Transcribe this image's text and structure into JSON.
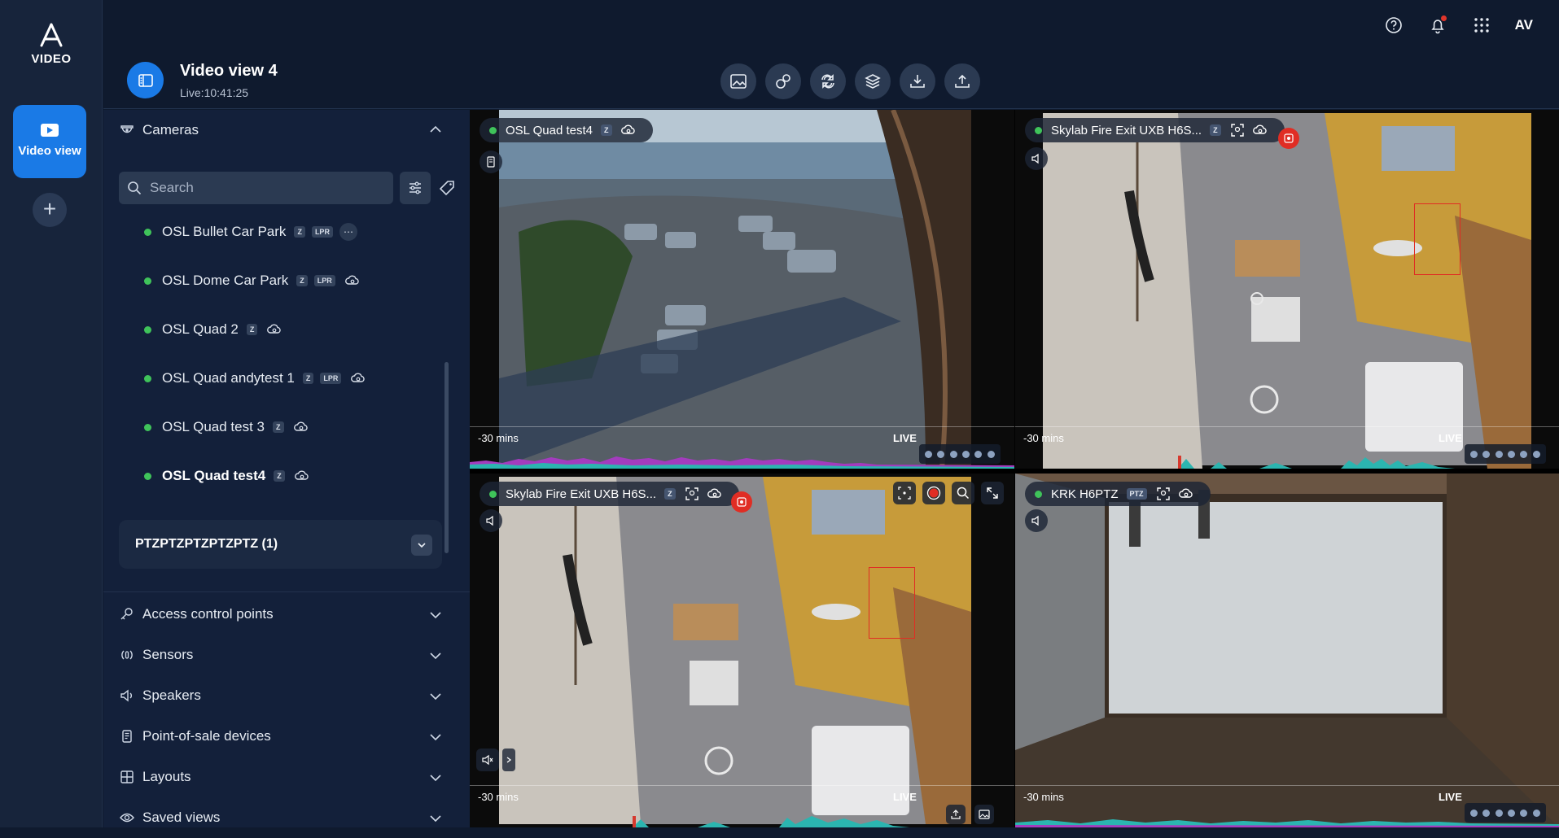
{
  "app": {
    "brand": "VIDEO",
    "avatar_initials": "AV"
  },
  "rail": {
    "active_label": "Video view",
    "add_label": "+"
  },
  "header": {
    "title": "Video view 4",
    "subtitle": "Live:10:41:25"
  },
  "sidebar": {
    "cameras_label": "Cameras",
    "search_placeholder": "Search",
    "cameras": [
      {
        "name": "OSL Bullet Car Park",
        "badges": [
          "Z",
          "LPR"
        ],
        "action": "more",
        "online": true,
        "bold": false
      },
      {
        "name": "OSL Dome Car Park",
        "badges": [
          "Z",
          "LPR"
        ],
        "action": "cloud",
        "online": true,
        "bold": false
      },
      {
        "name": "OSL Quad 2",
        "badges": [
          "Z"
        ],
        "action": "cloud",
        "online": true,
        "bold": false
      },
      {
        "name": "OSL Quad andytest 1",
        "badges": [
          "Z",
          "LPR"
        ],
        "action": "cloud",
        "online": true,
        "bold": false
      },
      {
        "name": "OSL Quad test 3",
        "badges": [
          "Z"
        ],
        "action": "cloud",
        "online": true,
        "bold": false
      },
      {
        "name": "OSL Quad test4",
        "badges": [
          "Z"
        ],
        "action": "cloud",
        "online": true,
        "bold": true
      }
    ],
    "group_label": "PTZPTZPTZPTZPTZ (1)",
    "sections": [
      {
        "label": "Access control points",
        "icon": "key-icon"
      },
      {
        "label": "Sensors",
        "icon": "sensor-icon"
      },
      {
        "label": "Speakers",
        "icon": "speaker-icon"
      },
      {
        "label": "Point-of-sale devices",
        "icon": "pos-icon"
      },
      {
        "label": "Layouts",
        "icon": "layout-grid-icon"
      },
      {
        "label": "Saved views",
        "icon": "eye-icon"
      }
    ]
  },
  "tiles": [
    {
      "name": "OSL Quad test4",
      "badge": "Z",
      "alert": false,
      "mins": "-30 mins",
      "live": "LIVE"
    },
    {
      "name": "Skylab Fire Exit UXB H6S...",
      "badge": "Z",
      "alert": true,
      "mins": "-30 mins",
      "live": "LIVE"
    },
    {
      "name": "Skylab Fire Exit UXB H6S...",
      "badge": "Z",
      "alert": true,
      "mins": "-30 mins",
      "live": "LIVE"
    },
    {
      "name": "KRK H6PTZ",
      "badge": "PTZ",
      "alert": false,
      "mins": "-30 mins",
      "live": "LIVE"
    }
  ],
  "colors": {
    "accent": "#1a7ae6",
    "alert": "#d6392e",
    "online": "#3fc35a",
    "background": "#0f1a2e"
  }
}
